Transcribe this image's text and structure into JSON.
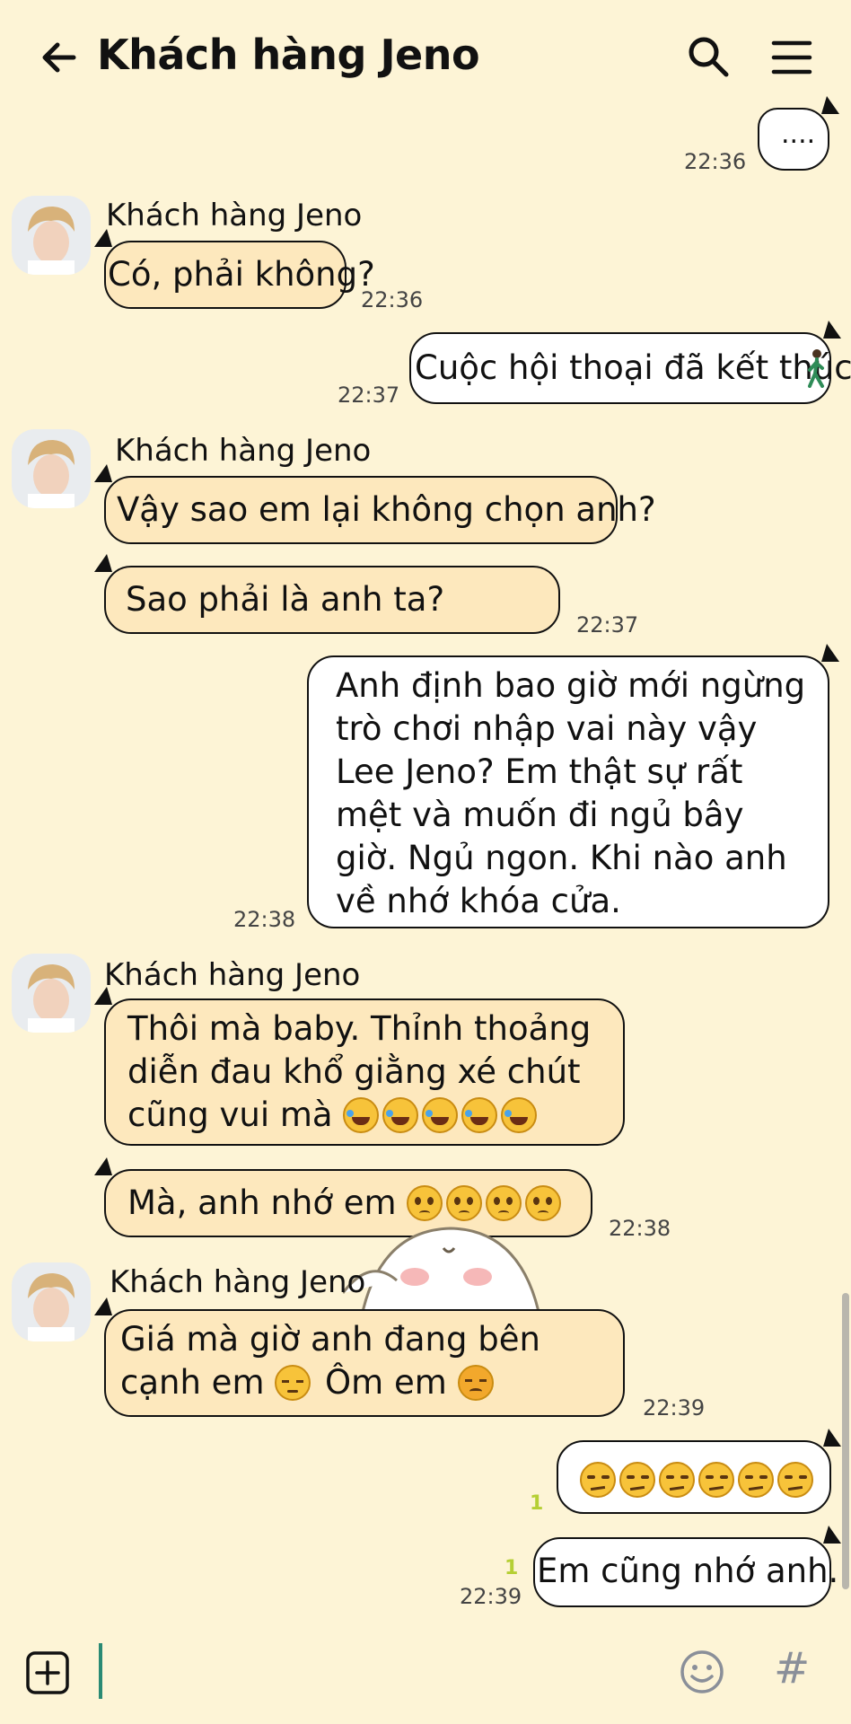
{
  "header": {
    "title": "Khách hàng Jeno",
    "back_icon": "arrow-left-icon",
    "search_icon": "search-icon",
    "menu_icon": "hamburger-menu-icon"
  },
  "messages": [
    {
      "dir": "out",
      "text": "....",
      "time": "22:36"
    },
    {
      "dir": "in",
      "sender": "Khách hàng Jeno",
      "text": "Có, phải không?",
      "time": "22:36"
    },
    {
      "dir": "out",
      "text": "Cuộc hội thoại đã kết thúc",
      "time": "22:37"
    },
    {
      "dir": "in",
      "sender": "Khách hàng Jeno",
      "text": "Vậy sao em lại không chọn anh?"
    },
    {
      "dir": "in",
      "text": "Sao phải là anh ta?",
      "time": "22:37"
    },
    {
      "dir": "out",
      "text": "Anh định bao giờ mới ngừng trò chơi nhập vai này vậy Lee Jeno? Em thật sự rất mệt và muốn đi ngủ bây giờ. Ngủ ngon. Khi nào anh về nhớ khóa cửa.",
      "time": "22:38"
    },
    {
      "dir": "in",
      "sender": "Khách hàng Jeno",
      "text": "Thôi mà baby. Thỉnh thoảng diễn đau khổ giằng xé chút cũng vui mà",
      "emoji": "rolling-laughing x5"
    },
    {
      "dir": "in",
      "text": "Mà, anh nhớ em",
      "emoji": "pleading-face x4",
      "time": "22:38"
    },
    {
      "dir": "in",
      "sender": "Khách hàng Jeno",
      "text_1": "Giá mà giờ anh đang bên",
      "text_2": "cạnh em",
      "text_3": "Ôm em",
      "emoji": "pensive-face, disappointed-face",
      "time": "22:39"
    },
    {
      "dir": "out",
      "text": "",
      "emoji": "unamused-face x6",
      "read": "1"
    },
    {
      "dir": "out",
      "text": "Em cũng nhớ anh.",
      "time": "22:39",
      "read": "1"
    }
  ],
  "input_bar": {
    "add_icon": "plus-square-icon",
    "emoji_icon": "smiley-icon",
    "hash": "#"
  },
  "colors": {
    "background": "#fdf4d6",
    "incoming_bubble": "#fde8bd",
    "outgoing_bubble": "#ffffff",
    "read_indicator": "#b5cf34",
    "cursor": "#2a8a74"
  }
}
